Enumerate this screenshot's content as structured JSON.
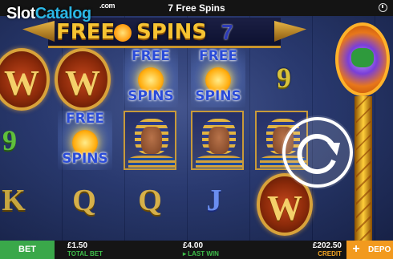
{
  "header": {
    "title": "7 Free Spins"
  },
  "watermark": {
    "part1": "Slot",
    "part2": "Catalog",
    "suffix": ".com"
  },
  "banner": {
    "word1": "FREE",
    "word2": "SPINS",
    "count": "7"
  },
  "symbols": {
    "free_spins_top": "FREE",
    "free_spins_bottom": "SPINS",
    "w_letter": "W",
    "nine": "9",
    "k": "K",
    "q": "Q",
    "j": "J"
  },
  "bottom": {
    "bet_label": "BET",
    "total_bet_value": "£1.50",
    "total_bet_label": "TOTAL BET",
    "last_win_value": "£4.00",
    "last_win_label": "LAST WIN",
    "last_win_icon": "play-icon",
    "credit_value": "£202.50",
    "credit_label": "CREDIT",
    "deposit_plus": "+",
    "deposit_label": "DEPO"
  },
  "colors": {
    "bet_green": "#3aa84a",
    "deposit_orange": "#f29a1f",
    "credit_orange": "#f5a623",
    "label_green": "#3fbf4a"
  }
}
